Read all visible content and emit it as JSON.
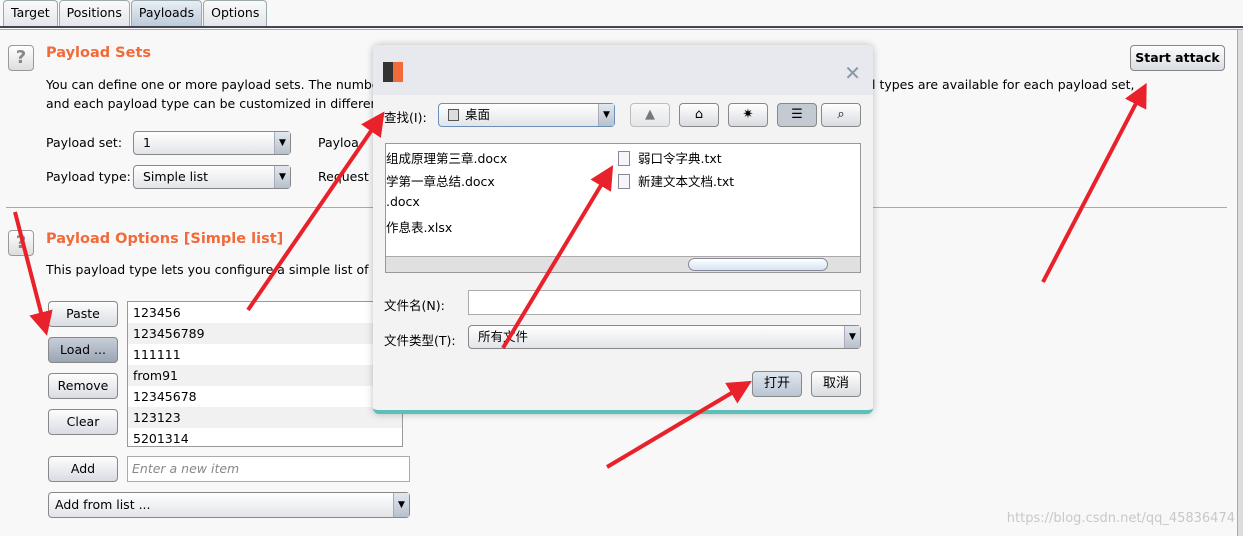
{
  "tabs": [
    {
      "label": "Target"
    },
    {
      "label": "Positions"
    },
    {
      "label": "Payloads",
      "active": true
    },
    {
      "label": "Options"
    }
  ],
  "payload_sets": {
    "title": "Payload Sets",
    "desc1": "You can define one or more payload sets. The number of",
    "desc1_tail": "l types are available for each payload set,",
    "desc2": "and each payload type can be customized in different wa",
    "set_label": "Payload set:",
    "set_value": "1",
    "type_label": "Payload type:",
    "type_value": "Simple list",
    "count_label": "Payloa",
    "request_label": "Request c",
    "start_attack": "Start attack"
  },
  "payload_options": {
    "title": "Payload Options [Simple list]",
    "desc": "This payload type lets you configure a simple list of string",
    "buttons": {
      "paste": "Paste",
      "load": "Load ...",
      "remove": "Remove",
      "clear": "Clear",
      "add": "Add"
    },
    "items": [
      "123456",
      "123456789",
      "111111",
      "from91",
      "12345678",
      "123123",
      "5201314"
    ],
    "new_item_placeholder": "Enter a new item",
    "add_from_list": "Add from list ..."
  },
  "dialog": {
    "lookin_label": "查找(I):",
    "lookin_value": "桌面",
    "files_left": [
      "组成原理第三章.docx",
      "学第一章总结.docx",
      ".docx",
      "作息表.xlsx"
    ],
    "files_right": [
      "弱口令字典.txt",
      "新建文本文档.txt"
    ],
    "filename_label": "文件名(N):",
    "filename_value": "",
    "filetype_label": "文件类型(T):",
    "filetype_value": "所有文件",
    "open": "打开",
    "cancel": "取消"
  },
  "watermark": "https://blog.csdn.net/qq_45836474",
  "colors": {
    "heading": "#f26a3a",
    "annotation_arrow": "#e8212b",
    "dialog_accent": "#5cc0b8"
  }
}
